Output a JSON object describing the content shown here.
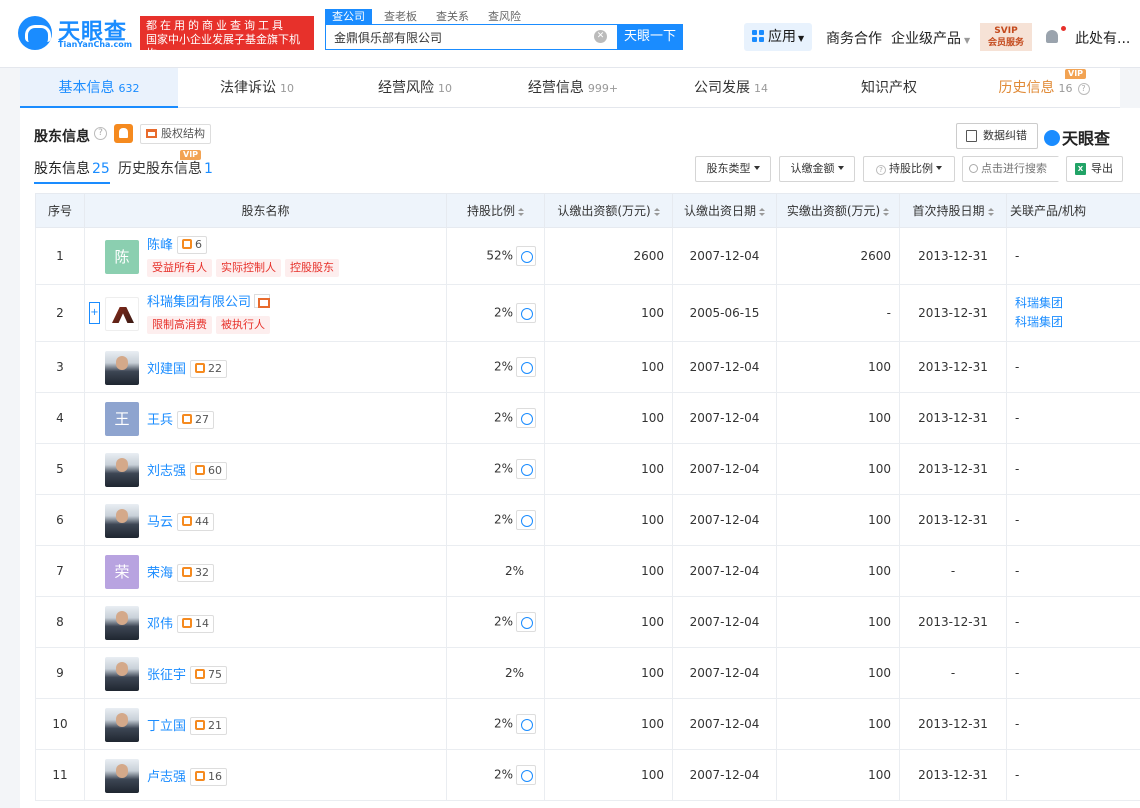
{
  "header": {
    "logo_text": "天眼查",
    "logo_sub": "TianYanCha.com",
    "slogan_line1": "都在用的商业查询工具",
    "slogan_line2": "国家中小企业发展子基金旗下机构",
    "search_tabs": [
      "查公司",
      "查老板",
      "查关系",
      "查风险"
    ],
    "search_value": "金鼎俱乐部有限公司",
    "search_button": "天眼一下",
    "nav_app": "应用",
    "nav_business": "商务合作",
    "nav_enterprise": "企业级产品",
    "svip_line1": "SVIP",
    "svip_line2": "会员服务",
    "user": "此处有..."
  },
  "main_tabs": [
    {
      "label": "基本信息",
      "count": "632"
    },
    {
      "label": "法律诉讼",
      "count": "10"
    },
    {
      "label": "经营风险",
      "count": "10"
    },
    {
      "label": "经营信息",
      "count": "999+"
    },
    {
      "label": "公司发展",
      "count": "14"
    },
    {
      "label": "知识产权",
      "count": ""
    },
    {
      "label": "历史信息",
      "count": "16"
    }
  ],
  "vip_label": "VIP",
  "section": {
    "title": "股东信息",
    "equity_btn": "股权结构",
    "error_btn": "数据纠错",
    "brand": "天眼查",
    "sub_tabs": [
      {
        "label": "股东信息",
        "count": "25"
      },
      {
        "label": "历史股东信息",
        "count": "1"
      }
    ],
    "filters": [
      "股东类型",
      "认缴金额",
      "持股比例"
    ],
    "search_placeholder": "点击进行搜索",
    "export": "导出"
  },
  "table": {
    "headers": [
      "序号",
      "股东名称",
      "持股比例",
      "认缴出资额(万元)",
      "认缴出资日期",
      "实缴出资额(万元)",
      "首次持股日期",
      "关联产品/机构"
    ],
    "rows": [
      {
        "idx": "1",
        "name": "陈峰",
        "avatar": "陈",
        "avatar_color": "#8bcfb0",
        "rel": "6",
        "tags": [
          "受益所有人",
          "实际控制人",
          "控股股东"
        ],
        "ratio": "52%",
        "sub_amt": "2600",
        "sub_date": "2007-12-04",
        "paid": "2600",
        "first": "2013-12-31",
        "related": [
          "-"
        ]
      },
      {
        "idx": "2",
        "name": "科瑞集团有限公司",
        "avatar": "",
        "avatar_color": "",
        "rel": "",
        "tags": [
          "限制高消费",
          "被执行人"
        ],
        "ratio": "2%",
        "sub_amt": "100",
        "sub_date": "2005-06-15",
        "paid": "-",
        "first": "2013-12-31",
        "related": [
          "科瑞集团",
          "科瑞集团"
        ]
      },
      {
        "idx": "3",
        "name": "刘建国",
        "avatar": "",
        "avatar_color": "",
        "rel": "22",
        "tags": [],
        "ratio": "2%",
        "sub_amt": "100",
        "sub_date": "2007-12-04",
        "paid": "100",
        "first": "2013-12-31",
        "related": [
          "-"
        ]
      },
      {
        "idx": "4",
        "name": "王兵",
        "avatar": "王",
        "avatar_color": "#8ea4cf",
        "rel": "27",
        "tags": [],
        "ratio": "2%",
        "sub_amt": "100",
        "sub_date": "2007-12-04",
        "paid": "100",
        "first": "2013-12-31",
        "related": [
          "-"
        ]
      },
      {
        "idx": "5",
        "name": "刘志强",
        "avatar": "",
        "avatar_color": "",
        "rel": "60",
        "tags": [],
        "ratio": "2%",
        "sub_amt": "100",
        "sub_date": "2007-12-04",
        "paid": "100",
        "first": "2013-12-31",
        "related": [
          "-"
        ]
      },
      {
        "idx": "6",
        "name": "马云",
        "avatar": "",
        "avatar_color": "",
        "rel": "44",
        "tags": [],
        "ratio": "2%",
        "sub_amt": "100",
        "sub_date": "2007-12-04",
        "paid": "100",
        "first": "2013-12-31",
        "related": [
          "-"
        ]
      },
      {
        "idx": "7",
        "name": "荣海",
        "avatar": "荣",
        "avatar_color": "#b8a3e0",
        "rel": "32",
        "tags": [],
        "ratio": "2%",
        "sub_amt": "100",
        "sub_date": "2007-12-04",
        "paid": "100",
        "first": "-",
        "related": [
          "-"
        ]
      },
      {
        "idx": "8",
        "name": "邓伟",
        "avatar": "",
        "avatar_color": "",
        "rel": "14",
        "tags": [],
        "ratio": "2%",
        "sub_amt": "100",
        "sub_date": "2007-12-04",
        "paid": "100",
        "first": "2013-12-31",
        "related": [
          "-"
        ]
      },
      {
        "idx": "9",
        "name": "张征宇",
        "avatar": "",
        "avatar_color": "",
        "rel": "75",
        "tags": [],
        "ratio": "2%",
        "sub_amt": "100",
        "sub_date": "2007-12-04",
        "paid": "100",
        "first": "-",
        "related": [
          "-"
        ]
      },
      {
        "idx": "10",
        "name": "丁立国",
        "avatar": "",
        "avatar_color": "",
        "rel": "21",
        "tags": [],
        "ratio": "2%",
        "sub_amt": "100",
        "sub_date": "2007-12-04",
        "paid": "100",
        "first": "2013-12-31",
        "related": [
          "-"
        ]
      },
      {
        "idx": "11",
        "name": "卢志强",
        "avatar": "",
        "avatar_color": "",
        "rel": "16",
        "tags": [],
        "ratio": "2%",
        "sub_amt": "100",
        "sub_date": "2007-12-04",
        "paid": "100",
        "first": "2013-12-31",
        "related": [
          "-"
        ]
      }
    ]
  }
}
